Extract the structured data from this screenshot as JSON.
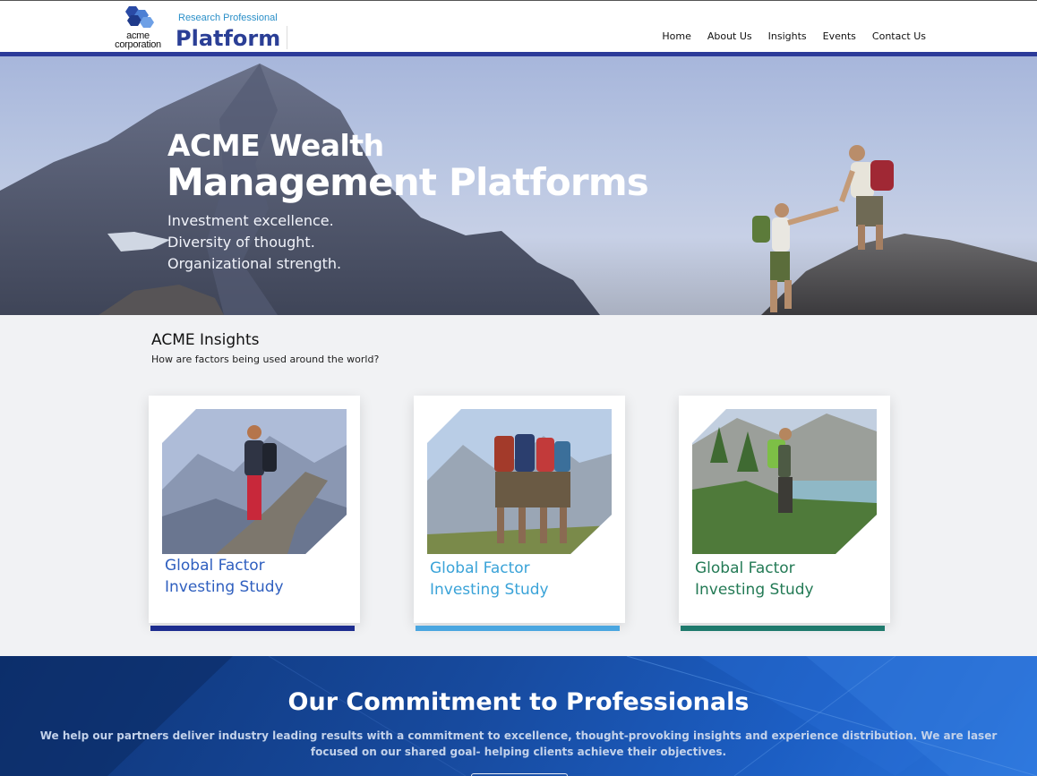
{
  "header": {
    "logo_line1": "acme",
    "logo_line2": "corporation",
    "brand_sub": "Research Professional",
    "brand_main": "Platform",
    "nav": [
      "Home",
      "About Us",
      "Insights",
      "Events",
      "Contact Us"
    ]
  },
  "hero": {
    "title_line1": "ACME Wealth",
    "title_line2": "Management Platforms",
    "taglines": [
      "Investment excellence.",
      "Diversity of thought.",
      "Organizational strength."
    ]
  },
  "insights": {
    "title": "ACME Insights",
    "subtitle": "How are factors being used around the world?",
    "cards": [
      {
        "title_line1": "Global Factor",
        "title_line2": "Investing Study",
        "color": "#2f5fbf",
        "bar_color": "#1d2d8f"
      },
      {
        "title_line1": "Global Factor",
        "title_line2": "Investing Study",
        "color": "#3aa3d8",
        "bar_color": "#4aa6e0"
      },
      {
        "title_line1": "Global Factor",
        "title_line2": "Investing Study",
        "color": "#237a55",
        "bar_color": "#1f7a6d"
      }
    ]
  },
  "commitment": {
    "title": "Our Commitment to Professionals",
    "text": "We help our partners deliver industry leading results with a commitment to excellence, thought-provoking insights and experience distribution. We are laser focused on our shared goal- helping clients achieve their objectives."
  }
}
